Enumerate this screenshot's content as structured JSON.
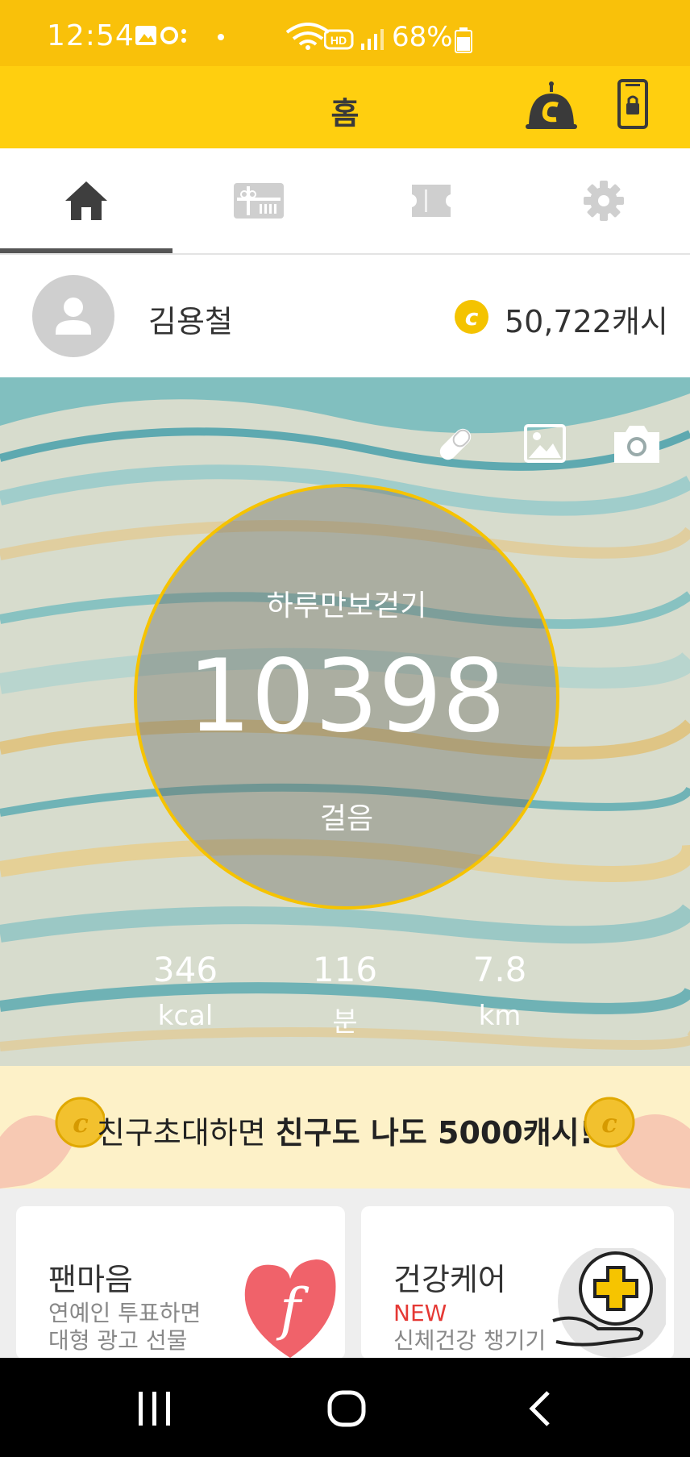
{
  "status_bar": {
    "time": "12:54",
    "battery": "68%"
  },
  "header": {
    "title": "홈"
  },
  "tabs": [
    {
      "name": "home",
      "icon": "home-icon",
      "active": true
    },
    {
      "name": "gift-shop",
      "icon": "gift-card-icon",
      "active": false
    },
    {
      "name": "coupon",
      "icon": "ticket-icon",
      "active": false
    },
    {
      "name": "settings",
      "icon": "gear-icon",
      "active": false
    }
  ],
  "profile": {
    "name": "김용철",
    "coin_symbol": "c",
    "cash": "50,722캐시"
  },
  "walk": {
    "title": "하루만보걷기",
    "steps": "10398",
    "steps_unit": "걸음",
    "stats": [
      {
        "value": "346",
        "unit": "kcal"
      },
      {
        "value": "116",
        "unit": "분"
      },
      {
        "value": "7.8",
        "unit": "km"
      }
    ]
  },
  "banner": {
    "text_regular": "친구초대하면 ",
    "text_bold": "친구도 나도 5000캐시!",
    "coin_symbol": "c"
  },
  "cards": [
    {
      "title": "팬마음",
      "badge": "",
      "line1": "연예인 투표하면",
      "line2": "대형 광고 선물"
    },
    {
      "title": "건강케어",
      "badge": "NEW",
      "line1": "신체건강 챙기기",
      "line2": ""
    }
  ],
  "colors": {
    "accent": "#ffcf0f",
    "status_bar": "#f9c10a",
    "ring": "#f6c300",
    "new_badge": "#e53935",
    "fan_heart": "#f0626a"
  }
}
